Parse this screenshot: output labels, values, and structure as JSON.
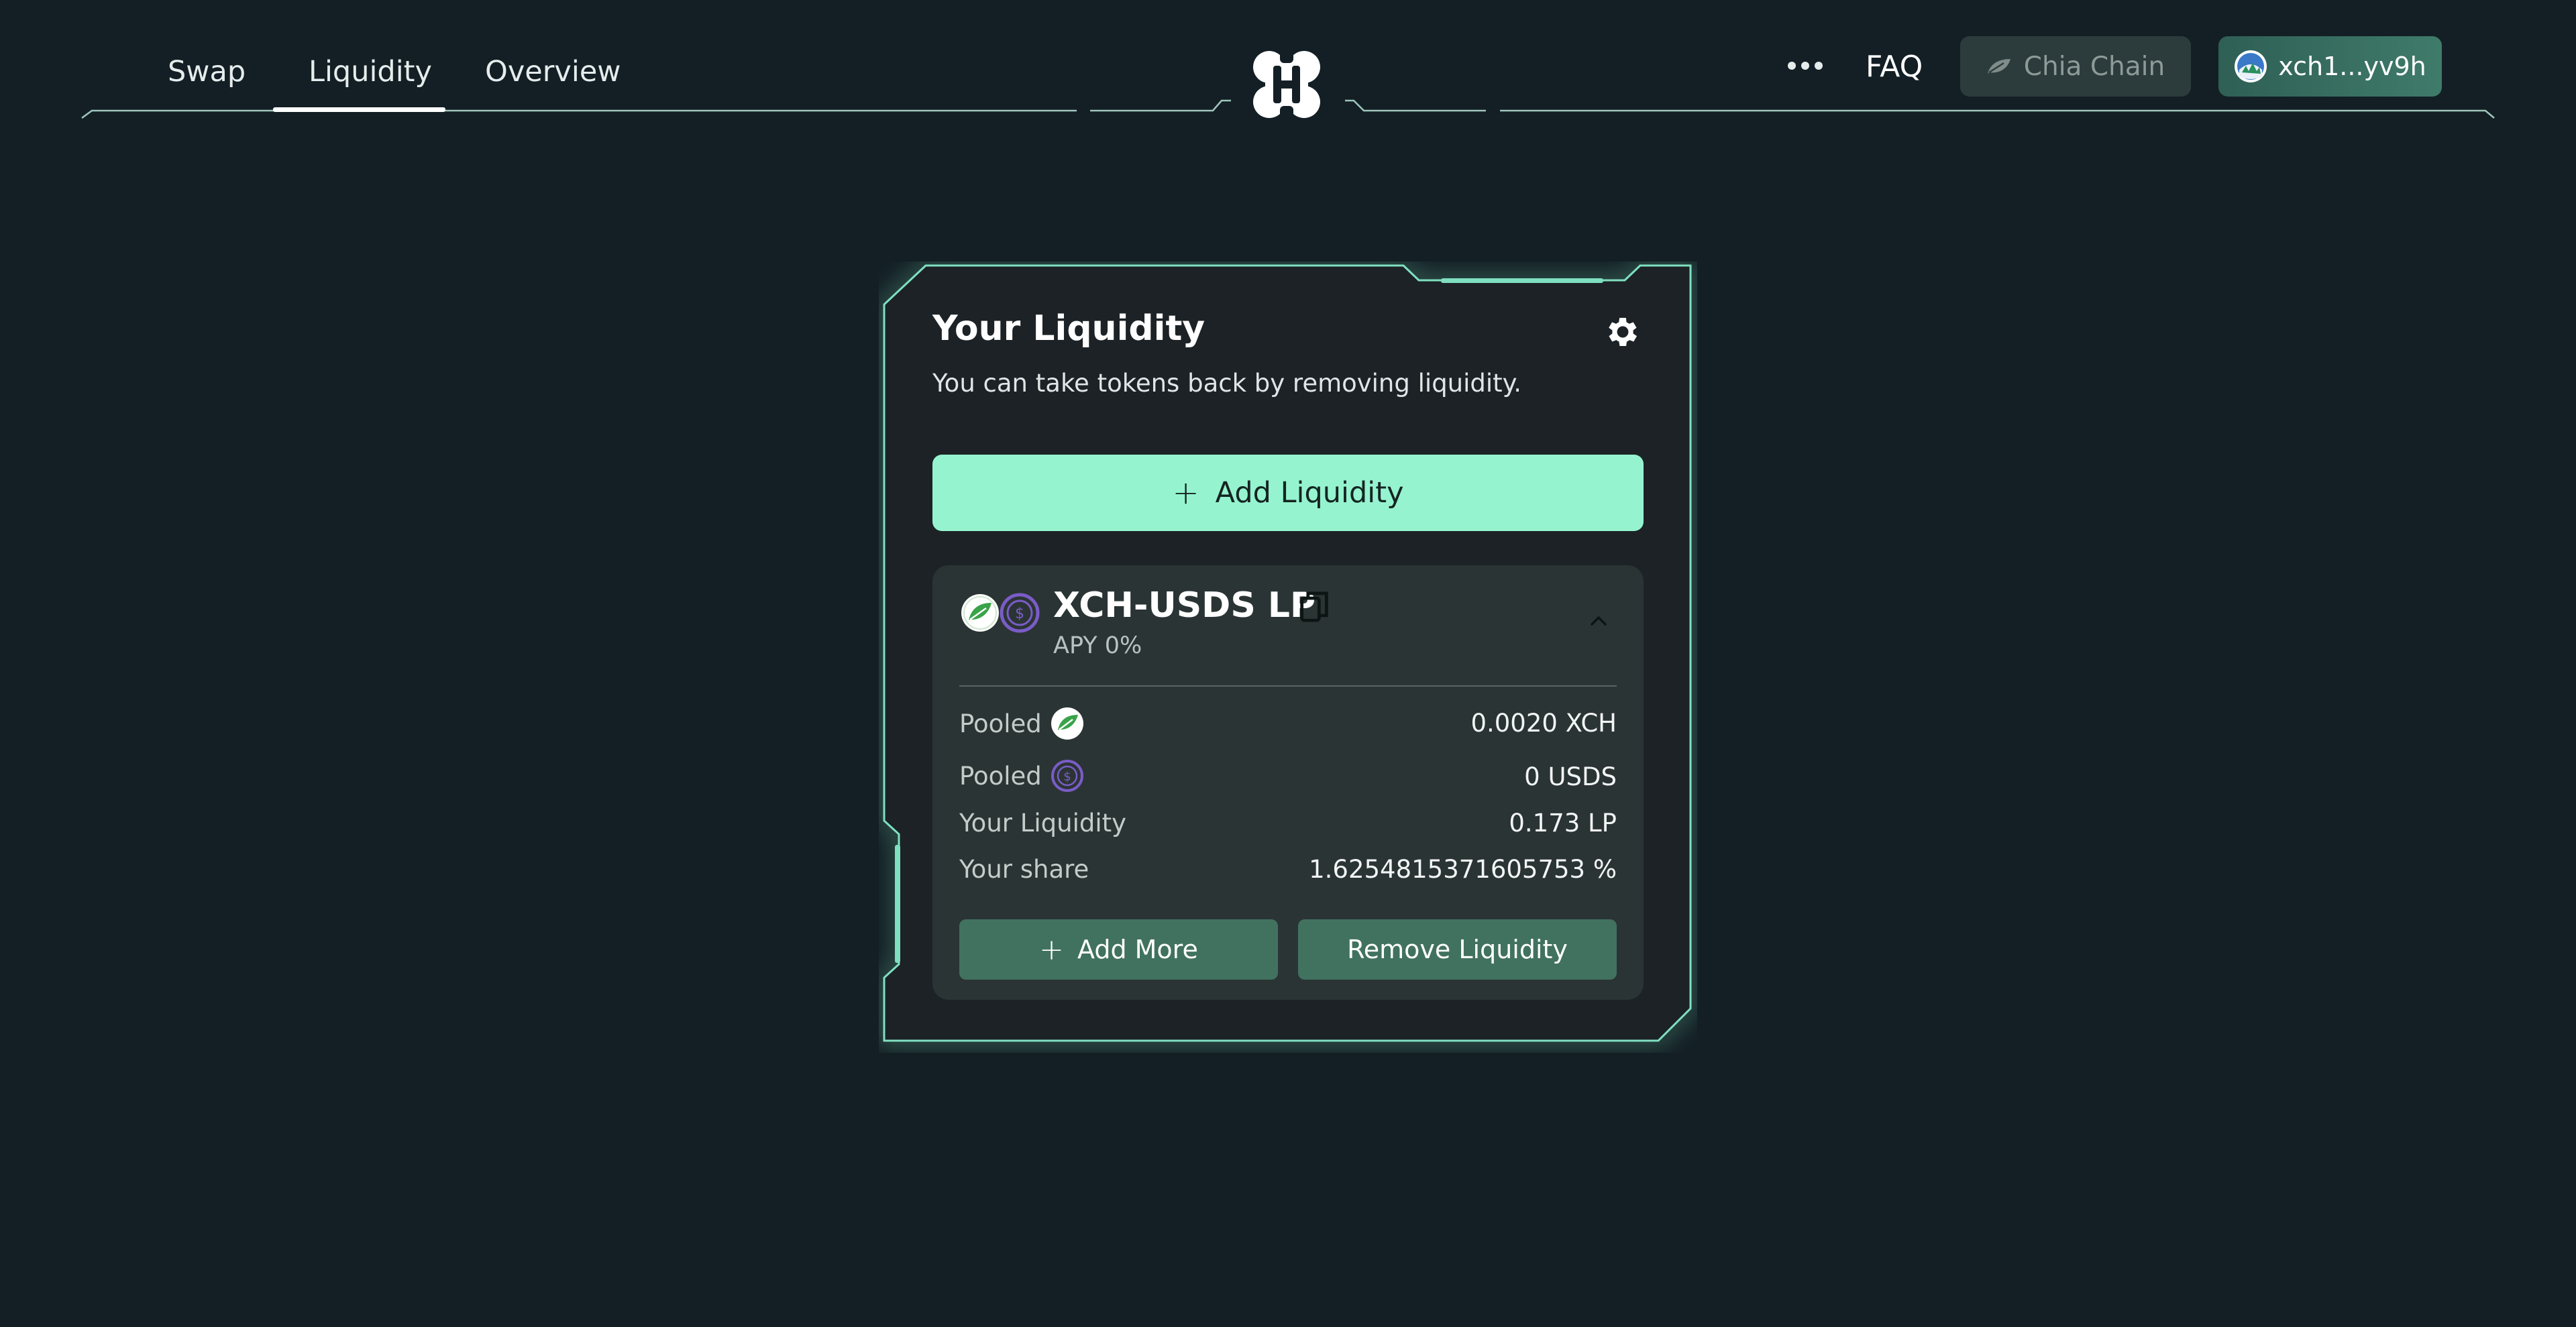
{
  "nav": {
    "tabs": [
      "Swap",
      "Liquidity",
      "Overview"
    ],
    "active_tab": "Liquidity",
    "faq": "FAQ",
    "chain_button": "Chia Chain",
    "wallet_button": "xch1...yv9h"
  },
  "card": {
    "title": "Your Liquidity",
    "subtitle": "You can take tokens back by removing liquidity.",
    "add_liquidity": "Add Liquidity",
    "position": {
      "name": "XCH-USDS LP",
      "apy": "APY 0%",
      "rows": [
        {
          "label": "Pooled",
          "icon": "xch-token-icon",
          "value": "0.0020 XCH"
        },
        {
          "label": "Pooled",
          "icon": "usds-token-icon",
          "value": "0 USDS"
        },
        {
          "label": "Your Liquidity",
          "value": "0.173 LP"
        },
        {
          "label": "Your share",
          "value": "1.6254815371605753 %"
        }
      ],
      "add_more": "Add More",
      "remove": "Remove Liquidity"
    }
  },
  "colors": {
    "background": "#131f25",
    "accent": "#95f4cf",
    "button_dark": "#41725f",
    "card_border": "#7fe0c0"
  },
  "icons": [
    "ellipsis-icon",
    "leaf-icon",
    "gear-icon",
    "copy-icon",
    "chevron-up-icon",
    "plus-icon",
    "wallet-avatar-icon",
    "logo-icon"
  ]
}
